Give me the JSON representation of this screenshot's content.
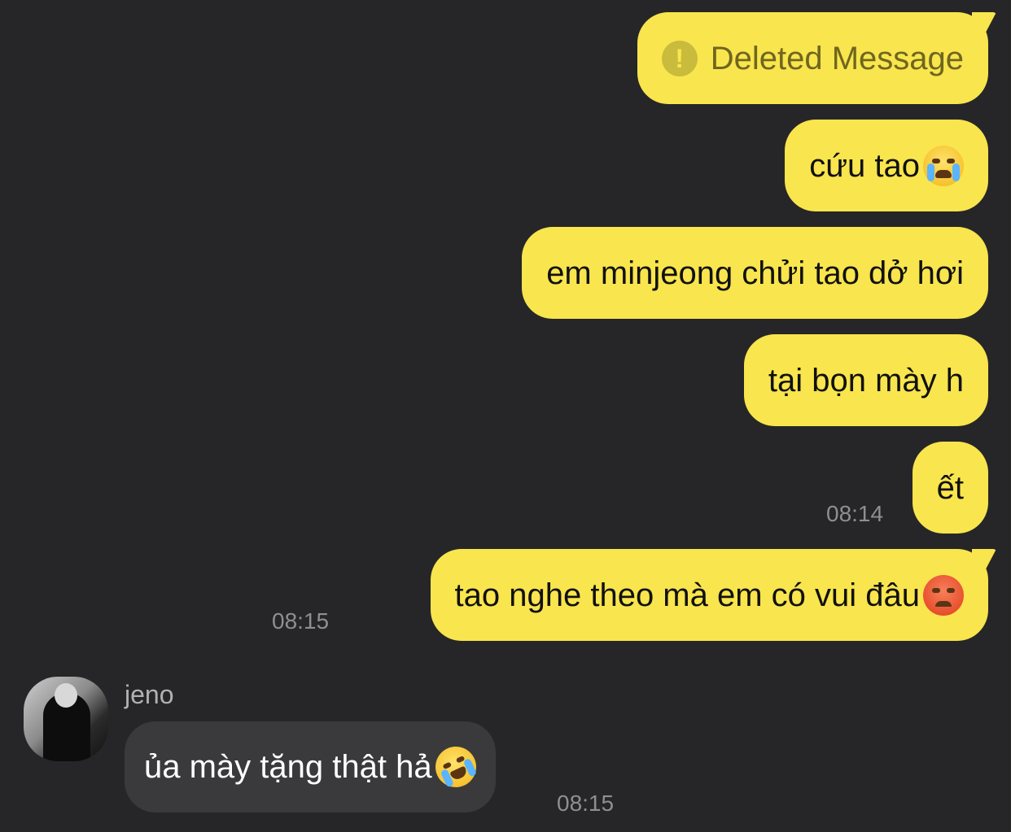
{
  "conversation": {
    "outgoing": [
      {
        "text": "Deleted Message",
        "deleted": true,
        "icon": "warning-icon"
      },
      {
        "text": "cứu tao",
        "emoji": "loudly-crying-face-emoji"
      },
      {
        "text": "em minjeong chửi tao dở hơi"
      },
      {
        "text": "tại bọn mày h"
      },
      {
        "text": "ết",
        "time": "08:14"
      },
      {
        "text": "tao nghe theo mà em có vui đâu",
        "emoji": "pouting-face-emoji",
        "time": "08:15"
      }
    ],
    "incoming": [
      {
        "sender": "jeno",
        "text": "ủa mày tặng thật hả",
        "emoji": "rolling-on-floor-laughing-emoji",
        "time": "08:15"
      }
    ]
  },
  "colors": {
    "background": "#262628",
    "outgoing_bubble": "#f9e54d",
    "incoming_bubble": "#3a3a3c",
    "timestamp": "#8e8e93"
  }
}
